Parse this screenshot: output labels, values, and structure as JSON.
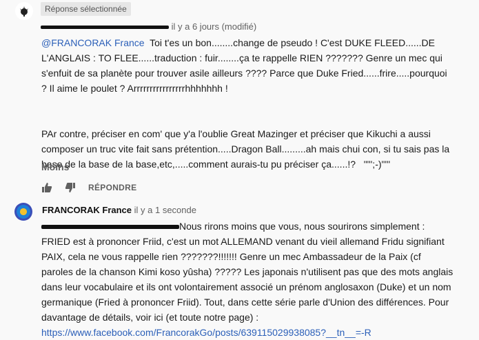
{
  "comment1": {
    "badge": "Réponse sélectionnée",
    "time": "il y a 6 jours (modifié)",
    "mention": "@FRANCORAK France",
    "text_after_mention": "  Toi t'es un bon........change de pseudo ! C'est DUKE FLEED......DE L'ANGLAIS : TO FLEE......traduction : fuir........ça te rappelle RIEN ??????? Genre un mec qui s'enfuit de sa planète pour trouver asile ailleurs ???? Parce que Duke Fried......frire.....pourquoi ? Il aime le poulet ? Arrrrrrrrrrrrrrrrhhhhhhh !\n\n\nPAr contre, préciser en com' que y'a l'oublie Great Mazinger et préciser que Kikuchi a aussi composer un truc vite fait sans prétention.....Dragon Ball.........ah mais chui con, si tu sais pas la base de la base de la base,etc,.....comment aurais-tu pu préciser ça......!?   \"\"';-)\"\"'",
    "less_label": "Moins",
    "reply_label": "RÉPONDRE"
  },
  "comment2": {
    "author": "FRANCORAK France",
    "time": "il y a 1 seconde",
    "text_after_mention": "Nous rirons moins que vous, nous sourirons simplement : FRIED est à prononcer Friid, c'est un mot ALLEMAND venant du vieil allemand Fridu signifiant PAIX, cela ne vous rappelle rien ???????!!!!!!! Genre un mec Ambassadeur de la Paix (cf paroles de la chanson Kimi koso yûsha) ????? Les japonais n'utilisent pas que des mots anglais dans leur vocabulaire et ils ont volontairement associé un prénom anglosaxon (Duke) et un nom germanique (Fried à prononcer Friid). Tout, dans cette série parle d'Union des différences. Pour davantage de détails, voir ici (et toute notre page) : ",
    "link": "https://www.facebook.com/FrancorakGo/posts/639115029938085?__tn__=-R"
  },
  "colors": {
    "link": "#2b5fb8",
    "meta": "#606060",
    "background": "#f9f9f9"
  },
  "icons": [
    "avatar-emblem",
    "thumbs-up-icon",
    "thumbs-down-icon",
    "avatar-francorak"
  ]
}
